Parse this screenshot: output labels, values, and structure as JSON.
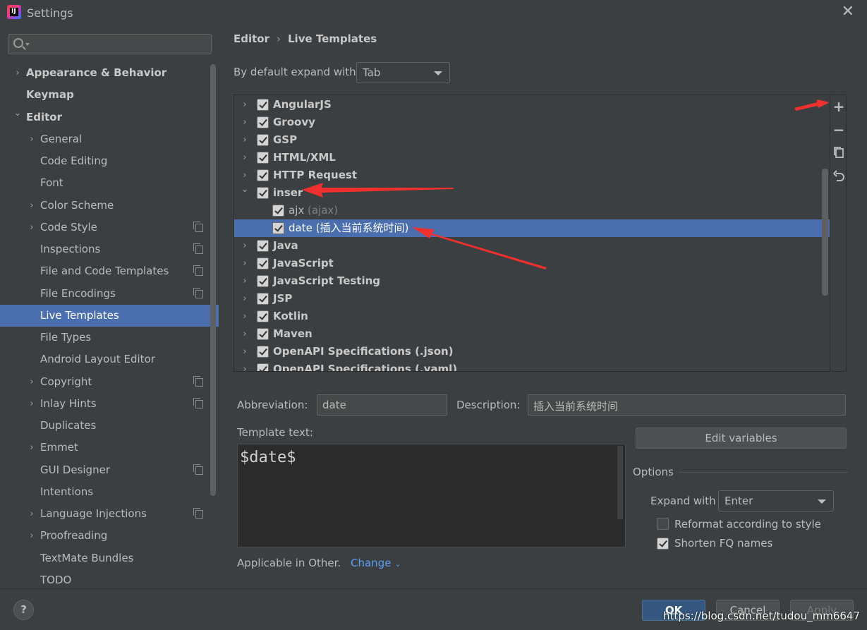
{
  "window": {
    "title": "Settings",
    "app_icon": "intellij-idea-icon"
  },
  "sidebar": {
    "search_placeholder": "",
    "items": [
      {
        "label": "Appearance & Behavior",
        "level": 0,
        "expandable": true,
        "expanded": false,
        "bold": true,
        "project": false
      },
      {
        "label": "Keymap",
        "level": 0,
        "expandable": false,
        "bold": true,
        "project": false
      },
      {
        "label": "Editor",
        "level": 0,
        "expandable": true,
        "expanded": true,
        "bold": true,
        "project": false
      },
      {
        "label": "General",
        "level": 1,
        "expandable": true,
        "project": false
      },
      {
        "label": "Code Editing",
        "level": 1,
        "expandable": false,
        "project": false
      },
      {
        "label": "Font",
        "level": 1,
        "expandable": false,
        "project": false
      },
      {
        "label": "Color Scheme",
        "level": 1,
        "expandable": true,
        "project": false
      },
      {
        "label": "Code Style",
        "level": 1,
        "expandable": true,
        "project": true
      },
      {
        "label": "Inspections",
        "level": 1,
        "expandable": false,
        "project": true
      },
      {
        "label": "File and Code Templates",
        "level": 1,
        "expandable": false,
        "project": true
      },
      {
        "label": "File Encodings",
        "level": 1,
        "expandable": false,
        "project": true
      },
      {
        "label": "Live Templates",
        "level": 1,
        "expandable": false,
        "project": false,
        "selected": true
      },
      {
        "label": "File Types",
        "level": 1,
        "expandable": false,
        "project": false
      },
      {
        "label": "Android Layout Editor",
        "level": 1,
        "expandable": false,
        "project": false
      },
      {
        "label": "Copyright",
        "level": 1,
        "expandable": true,
        "project": true
      },
      {
        "label": "Inlay Hints",
        "level": 1,
        "expandable": true,
        "project": true
      },
      {
        "label": "Duplicates",
        "level": 1,
        "expandable": false,
        "project": false
      },
      {
        "label": "Emmet",
        "level": 1,
        "expandable": true,
        "project": false
      },
      {
        "label": "GUI Designer",
        "level": 1,
        "expandable": false,
        "project": true
      },
      {
        "label": "Intentions",
        "level": 1,
        "expandable": false,
        "project": false
      },
      {
        "label": "Language Injections",
        "level": 1,
        "expandable": true,
        "project": true
      },
      {
        "label": "Proofreading",
        "level": 1,
        "expandable": true,
        "project": false
      },
      {
        "label": "TextMate Bundles",
        "level": 1,
        "expandable": false,
        "project": false
      },
      {
        "label": "TODO",
        "level": 1,
        "expandable": false,
        "project": false
      }
    ]
  },
  "breadcrumb": {
    "parent": "Editor",
    "separator": "›",
    "current": "Live Templates"
  },
  "expand_default": {
    "label": "By default expand with",
    "value": "Tab"
  },
  "templates": [
    {
      "label": "AngularJS",
      "type": "group",
      "expanded": false,
      "checked": true
    },
    {
      "label": "Groovy",
      "type": "group",
      "expanded": false,
      "checked": true
    },
    {
      "label": "GSP",
      "type": "group",
      "expanded": false,
      "checked": true
    },
    {
      "label": "HTML/XML",
      "type": "group",
      "expanded": false,
      "checked": true
    },
    {
      "label": "HTTP Request",
      "type": "group",
      "expanded": false,
      "checked": true
    },
    {
      "label": "inser",
      "type": "group",
      "expanded": true,
      "checked": true
    },
    {
      "label": "ajx",
      "desc": "(ajax)",
      "type": "child",
      "checked": true
    },
    {
      "label": "date",
      "desc": "(插入当前系统时间)",
      "type": "child",
      "checked": true,
      "selected": true
    },
    {
      "label": "Java",
      "type": "group",
      "expanded": false,
      "checked": true
    },
    {
      "label": "JavaScript",
      "type": "group",
      "expanded": false,
      "checked": true
    },
    {
      "label": "JavaScript Testing",
      "type": "group",
      "expanded": false,
      "checked": true
    },
    {
      "label": "JSP",
      "type": "group",
      "expanded": false,
      "checked": true
    },
    {
      "label": "Kotlin",
      "type": "group",
      "expanded": false,
      "checked": true
    },
    {
      "label": "Maven",
      "type": "group",
      "expanded": false,
      "checked": true
    },
    {
      "label": "OpenAPI Specifications (.json)",
      "type": "group",
      "expanded": false,
      "checked": true
    },
    {
      "label": "OpenAPI Specifications (.yaml)",
      "type": "group",
      "expanded": false,
      "checked": true
    }
  ],
  "toolbar": {
    "add": "+",
    "remove": "−",
    "copy_icon": "copy-icon",
    "restore_icon": "undo-icon"
  },
  "form": {
    "abbreviation_label": "Abbreviation:",
    "abbreviation_value": "date",
    "description_label": "Description:",
    "description_value": "插入当前系统时间",
    "template_text_label": "Template text:",
    "template_text": "$date$",
    "edit_variables": "Edit variables",
    "applicable_label": "Applicable in Other.",
    "change_link": "Change"
  },
  "options": {
    "title": "Options",
    "expand_with_label": "Expand with",
    "expand_with_value": "Enter",
    "reformat_label": "Reformat according to style",
    "reformat_checked": false,
    "shorten_label": "Shorten FQ names",
    "shorten_checked": true
  },
  "footer": {
    "help": "?",
    "ok": "OK",
    "cancel": "Cancel",
    "apply": "Apply"
  },
  "watermark": "https://blog.csdn.net/tudou_mm6647",
  "colors": {
    "accent": "#4b6eaf",
    "arrow": "#f0302f",
    "link": "#589df6"
  }
}
